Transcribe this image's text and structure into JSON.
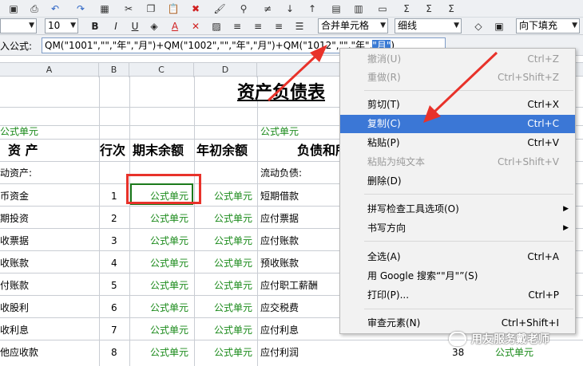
{
  "toolbar": {
    "font_size": "10",
    "bold": "B",
    "italic": "I",
    "underline": "U",
    "font_color_letter": "A",
    "merge_select": "合并单元格",
    "border_select": "细线",
    "fill_select": "向下填充"
  },
  "formula": {
    "label": "入公式:",
    "before_selection": "QM(\"1001\",\"\",\"年\",\"月\")+QM(\"1002\",\"\",\"年\",\"月\")+QM(\"1012\",\"\",\"年\",",
    "selection": "\"月\"",
    "after_selection": ")"
  },
  "columns": [
    "A",
    "B",
    "C",
    "D"
  ],
  "sheet": {
    "title": "资产负债表",
    "unit_left": "公式单元",
    "unit_right": "公式单元",
    "head_asset": "资    产",
    "head_line": "行次",
    "head_end": "期末余额",
    "head_begin": "年初余额",
    "head_liab": "负债和所",
    "current_assets": "动资产:",
    "current_liab": "流动负债:",
    "formula_cell": "公式单元",
    "rows": [
      {
        "asset": "币资金",
        "line": "1",
        "liab": "短期借款"
      },
      {
        "asset": "期投资",
        "line": "2",
        "liab": "应付票据"
      },
      {
        "asset": "收票据",
        "line": "3",
        "liab": "应付账款"
      },
      {
        "asset": "收账款",
        "line": "4",
        "liab": "预收账款"
      },
      {
        "asset": "付账款",
        "line": "5",
        "liab": "应付职工薪酬"
      },
      {
        "asset": "收股利",
        "line": "6",
        "liab": "应交税费"
      },
      {
        "asset": "收利息",
        "line": "7",
        "liab": "应付利息"
      },
      {
        "asset": "他应收款",
        "line": "8",
        "liab": "应付利润"
      }
    ],
    "last_row_right_line": "38",
    "last_row_right_value": "公式单元"
  },
  "context_menu": {
    "items": [
      {
        "label": "撤消(U)",
        "shortcut": "Ctrl+Z"
      },
      {
        "label": "重做(R)",
        "shortcut": "Ctrl+Shift+Z"
      },
      {
        "label": "剪切(T)",
        "shortcut": "Ctrl+X"
      },
      {
        "label": "复制(C)",
        "shortcut": "Ctrl+C"
      },
      {
        "label": "粘贴(P)",
        "shortcut": "Ctrl+V"
      },
      {
        "label": "粘贴为纯文本",
        "shortcut": "Ctrl+Shift+V"
      },
      {
        "label": "删除(D)",
        "shortcut": ""
      },
      {
        "label": "拼写检查工具选项(O)",
        "shortcut": ""
      },
      {
        "label": "书写方向",
        "shortcut": ""
      },
      {
        "label": "全选(A)",
        "shortcut": "Ctrl+A"
      },
      {
        "label": "用 Google 搜索“\"月\"”(S)",
        "shortcut": ""
      },
      {
        "label": "打印(P)...",
        "shortcut": "Ctrl+P"
      },
      {
        "label": "审查元素(N)",
        "shortcut": "Ctrl+Shift+I"
      }
    ]
  },
  "watermark": "用友服务戴老师",
  "colors": {
    "highlight": "#3b77d6",
    "green_text": "#1a8a1a",
    "red_mark": "#e8322a"
  }
}
